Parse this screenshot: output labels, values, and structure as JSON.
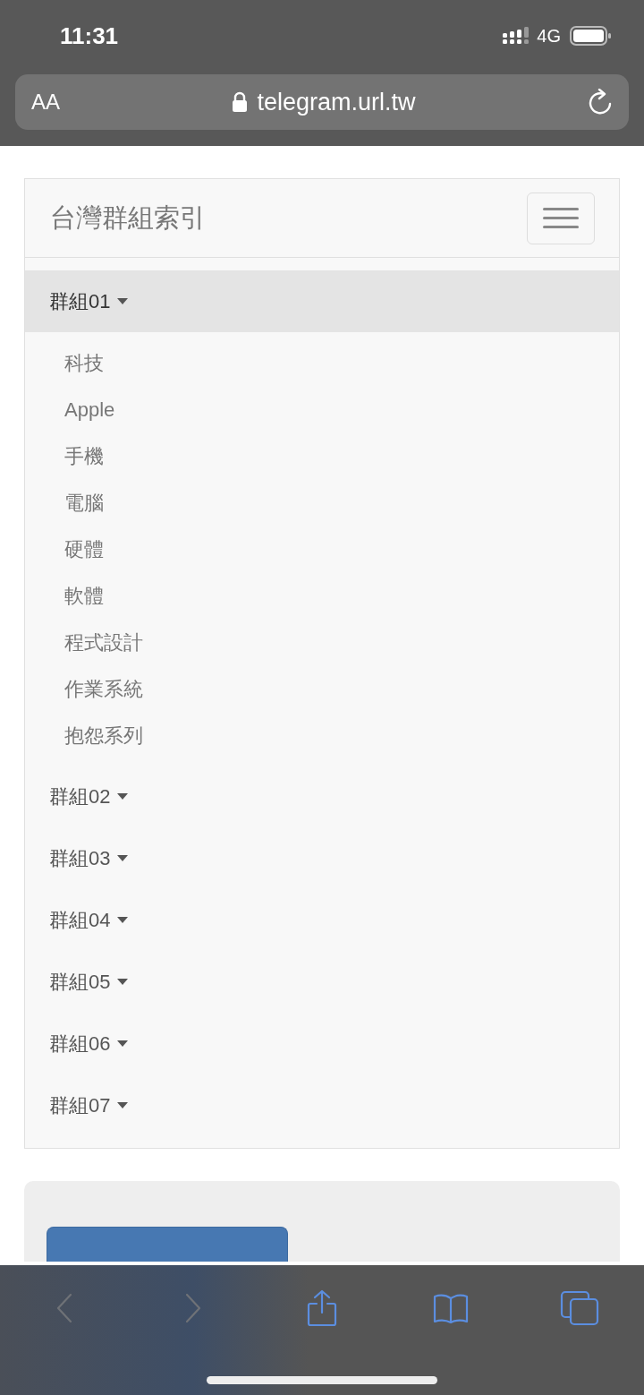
{
  "status_bar": {
    "time": "11:31",
    "network": "4G"
  },
  "address_bar": {
    "text_size_button": "AA",
    "url": "telegram.url.tw"
  },
  "navbar": {
    "brand": "台灣群組索引",
    "groups": [
      {
        "label": "群組01",
        "expanded": true,
        "children": [
          {
            "label": "科技"
          },
          {
            "label": "Apple"
          },
          {
            "label": "手機"
          },
          {
            "label": "電腦"
          },
          {
            "label": "硬體"
          },
          {
            "label": "軟體"
          },
          {
            "label": "程式設計"
          },
          {
            "label": "作業系統"
          },
          {
            "label": "抱怨系列"
          }
        ]
      },
      {
        "label": "群組02",
        "expanded": false
      },
      {
        "label": "群組03",
        "expanded": false
      },
      {
        "label": "群組04",
        "expanded": false
      },
      {
        "label": "群組05",
        "expanded": false
      },
      {
        "label": "群組06",
        "expanded": false
      },
      {
        "label": "群組07",
        "expanded": false
      }
    ]
  },
  "toolbar": {
    "buttons": [
      {
        "kind": "back",
        "disabled": true
      },
      {
        "kind": "forward",
        "disabled": true
      },
      {
        "kind": "share",
        "disabled": false
      },
      {
        "kind": "bookmarks",
        "disabled": false
      },
      {
        "kind": "tabs",
        "disabled": false
      }
    ]
  }
}
